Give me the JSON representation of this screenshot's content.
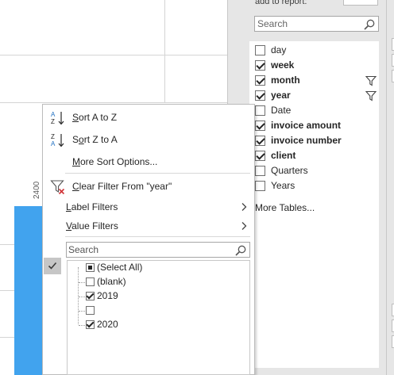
{
  "field_pane": {
    "header_text": "add to report:",
    "search_placeholder": "Search",
    "fields": [
      {
        "label": "day",
        "checked": false,
        "bold": false,
        "filtered": false
      },
      {
        "label": "week",
        "checked": true,
        "bold": true,
        "filtered": false
      },
      {
        "label": "month",
        "checked": true,
        "bold": true,
        "filtered": true
      },
      {
        "label": "year",
        "checked": true,
        "bold": true,
        "filtered": true
      },
      {
        "label": "Date",
        "checked": false,
        "bold": false,
        "filtered": false
      },
      {
        "label": "invoice amount",
        "checked": true,
        "bold": true,
        "filtered": false
      },
      {
        "label": "invoice number",
        "checked": true,
        "bold": true,
        "filtered": false
      },
      {
        "label": "client",
        "checked": true,
        "bold": true,
        "filtered": false
      },
      {
        "label": "Quarters",
        "checked": false,
        "bold": false,
        "filtered": false
      },
      {
        "label": "Years",
        "checked": false,
        "bold": false,
        "filtered": false
      }
    ],
    "more_tables": "More Tables..."
  },
  "chart": {
    "axis_label": "2400",
    "bar_color": "#41a3ee"
  },
  "menu": {
    "sort_az": {
      "pre": "",
      "key": "S",
      "post": "ort A to Z"
    },
    "sort_za": {
      "pre": "S",
      "key": "o",
      "post": "rt Z to A"
    },
    "more_sort": {
      "pre": "",
      "key": "M",
      "post": "ore Sort Options..."
    },
    "clear_filter": {
      "pre": "",
      "key": "C",
      "post": "lear Filter From \"year\""
    },
    "label_filters": {
      "pre": "",
      "key": "L",
      "post": "abel Filters"
    },
    "value_filters": {
      "pre": "",
      "key": "V",
      "post": "alue Filters"
    },
    "search_placeholder": "Search",
    "tree": [
      {
        "label": "(Select All)",
        "state": "partial"
      },
      {
        "label": "(blank)",
        "state": "unchecked"
      },
      {
        "label": "2019",
        "state": "checked"
      },
      {
        "label": "",
        "state": "unchecked"
      },
      {
        "label": "2020",
        "state": "checked"
      }
    ]
  },
  "colors": {
    "accent_blue": "#1e6fc2",
    "filter_clear_red": "#d13438",
    "pane_bg": "#e6e6e6"
  }
}
